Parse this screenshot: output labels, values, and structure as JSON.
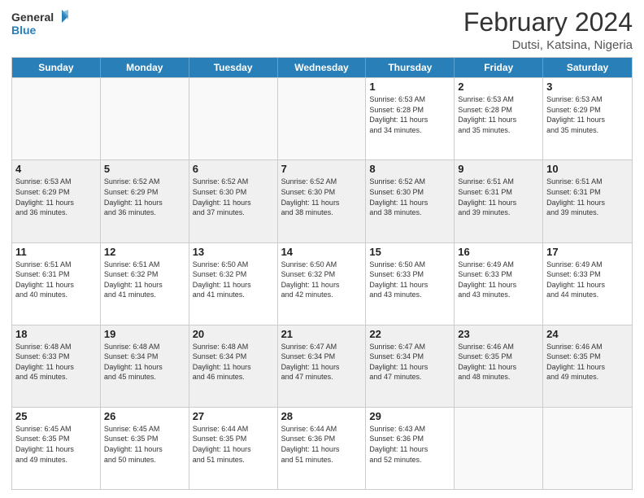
{
  "header": {
    "logo_line1": "General",
    "logo_line2": "Blue",
    "title": "February 2024",
    "subtitle": "Dutsi, Katsina, Nigeria"
  },
  "weekdays": [
    "Sunday",
    "Monday",
    "Tuesday",
    "Wednesday",
    "Thursday",
    "Friday",
    "Saturday"
  ],
  "rows": [
    [
      {
        "day": "",
        "info": ""
      },
      {
        "day": "",
        "info": ""
      },
      {
        "day": "",
        "info": ""
      },
      {
        "day": "",
        "info": ""
      },
      {
        "day": "1",
        "info": "Sunrise: 6:53 AM\nSunset: 6:28 PM\nDaylight: 11 hours\nand 34 minutes."
      },
      {
        "day": "2",
        "info": "Sunrise: 6:53 AM\nSunset: 6:28 PM\nDaylight: 11 hours\nand 35 minutes."
      },
      {
        "day": "3",
        "info": "Sunrise: 6:53 AM\nSunset: 6:29 PM\nDaylight: 11 hours\nand 35 minutes."
      }
    ],
    [
      {
        "day": "4",
        "info": "Sunrise: 6:53 AM\nSunset: 6:29 PM\nDaylight: 11 hours\nand 36 minutes."
      },
      {
        "day": "5",
        "info": "Sunrise: 6:52 AM\nSunset: 6:29 PM\nDaylight: 11 hours\nand 36 minutes."
      },
      {
        "day": "6",
        "info": "Sunrise: 6:52 AM\nSunset: 6:30 PM\nDaylight: 11 hours\nand 37 minutes."
      },
      {
        "day": "7",
        "info": "Sunrise: 6:52 AM\nSunset: 6:30 PM\nDaylight: 11 hours\nand 38 minutes."
      },
      {
        "day": "8",
        "info": "Sunrise: 6:52 AM\nSunset: 6:30 PM\nDaylight: 11 hours\nand 38 minutes."
      },
      {
        "day": "9",
        "info": "Sunrise: 6:51 AM\nSunset: 6:31 PM\nDaylight: 11 hours\nand 39 minutes."
      },
      {
        "day": "10",
        "info": "Sunrise: 6:51 AM\nSunset: 6:31 PM\nDaylight: 11 hours\nand 39 minutes."
      }
    ],
    [
      {
        "day": "11",
        "info": "Sunrise: 6:51 AM\nSunset: 6:31 PM\nDaylight: 11 hours\nand 40 minutes."
      },
      {
        "day": "12",
        "info": "Sunrise: 6:51 AM\nSunset: 6:32 PM\nDaylight: 11 hours\nand 41 minutes."
      },
      {
        "day": "13",
        "info": "Sunrise: 6:50 AM\nSunset: 6:32 PM\nDaylight: 11 hours\nand 41 minutes."
      },
      {
        "day": "14",
        "info": "Sunrise: 6:50 AM\nSunset: 6:32 PM\nDaylight: 11 hours\nand 42 minutes."
      },
      {
        "day": "15",
        "info": "Sunrise: 6:50 AM\nSunset: 6:33 PM\nDaylight: 11 hours\nand 43 minutes."
      },
      {
        "day": "16",
        "info": "Sunrise: 6:49 AM\nSunset: 6:33 PM\nDaylight: 11 hours\nand 43 minutes."
      },
      {
        "day": "17",
        "info": "Sunrise: 6:49 AM\nSunset: 6:33 PM\nDaylight: 11 hours\nand 44 minutes."
      }
    ],
    [
      {
        "day": "18",
        "info": "Sunrise: 6:48 AM\nSunset: 6:33 PM\nDaylight: 11 hours\nand 45 minutes."
      },
      {
        "day": "19",
        "info": "Sunrise: 6:48 AM\nSunset: 6:34 PM\nDaylight: 11 hours\nand 45 minutes."
      },
      {
        "day": "20",
        "info": "Sunrise: 6:48 AM\nSunset: 6:34 PM\nDaylight: 11 hours\nand 46 minutes."
      },
      {
        "day": "21",
        "info": "Sunrise: 6:47 AM\nSunset: 6:34 PM\nDaylight: 11 hours\nand 47 minutes."
      },
      {
        "day": "22",
        "info": "Sunrise: 6:47 AM\nSunset: 6:34 PM\nDaylight: 11 hours\nand 47 minutes."
      },
      {
        "day": "23",
        "info": "Sunrise: 6:46 AM\nSunset: 6:35 PM\nDaylight: 11 hours\nand 48 minutes."
      },
      {
        "day": "24",
        "info": "Sunrise: 6:46 AM\nSunset: 6:35 PM\nDaylight: 11 hours\nand 49 minutes."
      }
    ],
    [
      {
        "day": "25",
        "info": "Sunrise: 6:45 AM\nSunset: 6:35 PM\nDaylight: 11 hours\nand 49 minutes."
      },
      {
        "day": "26",
        "info": "Sunrise: 6:45 AM\nSunset: 6:35 PM\nDaylight: 11 hours\nand 50 minutes."
      },
      {
        "day": "27",
        "info": "Sunrise: 6:44 AM\nSunset: 6:35 PM\nDaylight: 11 hours\nand 51 minutes."
      },
      {
        "day": "28",
        "info": "Sunrise: 6:44 AM\nSunset: 6:36 PM\nDaylight: 11 hours\nand 51 minutes."
      },
      {
        "day": "29",
        "info": "Sunrise: 6:43 AM\nSunset: 6:36 PM\nDaylight: 11 hours\nand 52 minutes."
      },
      {
        "day": "",
        "info": ""
      },
      {
        "day": "",
        "info": ""
      }
    ]
  ]
}
